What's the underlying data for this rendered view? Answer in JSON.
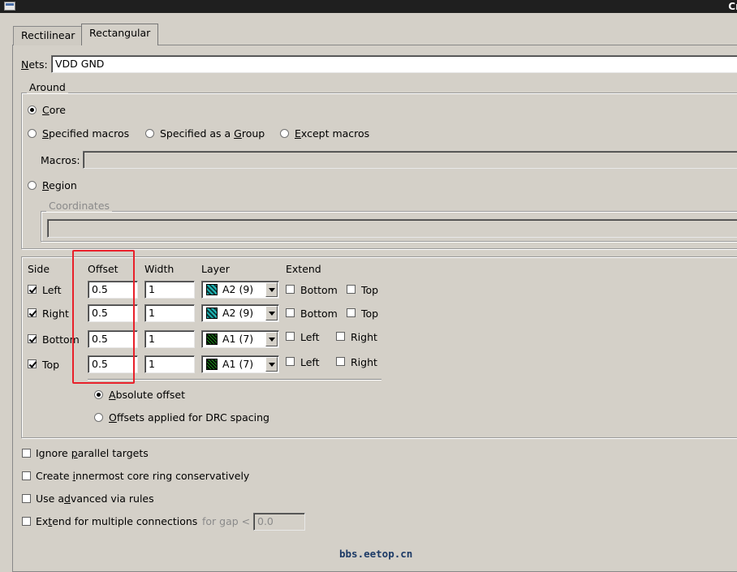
{
  "window": {
    "title": "Cr"
  },
  "tabs": [
    {
      "label": "Rectilinear"
    },
    {
      "label": "Rectangular"
    }
  ],
  "nets": {
    "label_u": "N",
    "label_rest": "ets:",
    "value": "VDD GND"
  },
  "around": {
    "legend": "Around",
    "core": {
      "u": "C",
      "rest": "ore"
    },
    "specified_macros": {
      "u": "S",
      "rest": "pecified macros"
    },
    "specified_group": {
      "pre": "Specified as a ",
      "u": "G",
      "rest": "roup"
    },
    "except_macros": {
      "u": "E",
      "rest": "xcept macros"
    },
    "macros_label": "Macros:",
    "macros_value": "",
    "region": {
      "u": "R",
      "rest": "egion"
    },
    "coordinates_legend": "Coordinates",
    "coordinates_value": ""
  },
  "sides": {
    "headers": {
      "side": "Side",
      "offset": "Offset",
      "width": "Width",
      "layer": "Layer",
      "extend": "Extend"
    },
    "rows": [
      {
        "side": "Left",
        "checked": true,
        "offset": "0.5",
        "width": "1",
        "layer": "A2 (9)",
        "swatch": "a2",
        "ext1": "Bottom",
        "ext2": "Top"
      },
      {
        "side": "Right",
        "checked": true,
        "offset": "0.5",
        "width": "1",
        "layer": "A2 (9)",
        "swatch": "a2",
        "ext1": "Bottom",
        "ext2": "Top"
      },
      {
        "side": "Bottom",
        "checked": true,
        "offset": "0.5",
        "width": "1",
        "layer": "A1 (7)",
        "swatch": "a1",
        "ext1": "Left",
        "ext2": "Right"
      },
      {
        "side": "Top",
        "checked": true,
        "offset": "0.5",
        "width": "1",
        "layer": "A1 (7)",
        "swatch": "a1",
        "ext1": "Left",
        "ext2": "Right"
      }
    ],
    "absolute_offset": {
      "u": "A",
      "rest": "bsolute offset"
    },
    "drc_offset": {
      "u": "O",
      "rest": "ffsets applied for DRC spacing"
    }
  },
  "options": {
    "ignore_parallel": {
      "pre": "Ignore ",
      "u": "p",
      "rest": "arallel targets"
    },
    "innermost": {
      "pre": "Create ",
      "u": "i",
      "rest": "nnermost core ring conservatively"
    },
    "advanced_via": {
      "pre": "Use a",
      "u": "d",
      "rest": "vanced via rules"
    },
    "extend_multiple": {
      "pre": "Ex",
      "u": "t",
      "rest": "end for multiple connections"
    },
    "gap_label": "for gap <",
    "gap_value": "0.0"
  },
  "watermark": "bbs.eetop.cn",
  "colors": {
    "background": "#d4d0c8",
    "highlight_box": "#e8202a",
    "titlebar": "#1f1f1f"
  }
}
